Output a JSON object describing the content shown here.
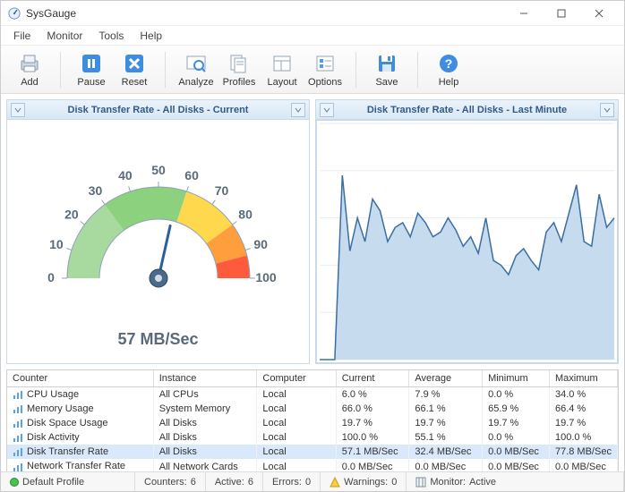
{
  "window": {
    "title": "SysGauge"
  },
  "menu": {
    "file": "File",
    "monitor": "Monitor",
    "tools": "Tools",
    "help": "Help"
  },
  "toolbar": {
    "add": "Add",
    "pause": "Pause",
    "reset": "Reset",
    "analyze": "Analyze",
    "profiles": "Profiles",
    "layout": "Layout",
    "options": "Options",
    "save": "Save",
    "help": "Help"
  },
  "panels": {
    "gauge": {
      "title": "Disk Transfer Rate - All Disks - Current",
      "value_label": "57 MB/Sec",
      "value": 57,
      "max": 100,
      "ticks": [
        "0",
        "10",
        "20",
        "30",
        "40",
        "50",
        "60",
        "70",
        "80",
        "90",
        "100"
      ]
    },
    "chart": {
      "title": "Disk Transfer Rate - All Disks - Last Minute"
    }
  },
  "chart_data": {
    "type": "line",
    "title": "Disk Transfer Rate - All Disks - Last Minute",
    "xlabel": "",
    "ylabel": "",
    "ylim": [
      0,
      100
    ],
    "x": [
      0,
      1,
      2,
      3,
      4,
      5,
      6,
      7,
      8,
      9,
      10,
      11,
      12,
      13,
      14,
      15,
      16,
      17,
      18,
      19,
      20,
      21,
      22,
      23,
      24,
      25,
      26,
      27,
      28,
      29,
      30,
      31,
      32,
      33,
      34,
      35,
      36,
      37,
      38,
      39
    ],
    "values": [
      0,
      0,
      0,
      78,
      46,
      60,
      50,
      68,
      63,
      50,
      56,
      58,
      52,
      62,
      58,
      52,
      54,
      60,
      55,
      48,
      52,
      45,
      60,
      42,
      40,
      36,
      44,
      47,
      42,
      38,
      54,
      58,
      50,
      62,
      74,
      50,
      48,
      70,
      56,
      60
    ]
  },
  "counters": {
    "headers": {
      "counter": "Counter",
      "instance": "Instance",
      "computer": "Computer",
      "current": "Current",
      "average": "Average",
      "minimum": "Minimum",
      "maximum": "Maximum"
    },
    "rows": [
      {
        "counter": "CPU Usage",
        "instance": "All CPUs",
        "computer": "Local",
        "current": "6.0 %",
        "average": "7.9 %",
        "minimum": "0.0 %",
        "maximum": "34.0 %"
      },
      {
        "counter": "Memory Usage",
        "instance": "System Memory",
        "computer": "Local",
        "current": "66.0 %",
        "average": "66.1 %",
        "minimum": "65.9 %",
        "maximum": "66.4 %"
      },
      {
        "counter": "Disk Space Usage",
        "instance": "All Disks",
        "computer": "Local",
        "current": "19.7 %",
        "average": "19.7 %",
        "minimum": "19.7 %",
        "maximum": "19.7 %"
      },
      {
        "counter": "Disk Activity",
        "instance": "All Disks",
        "computer": "Local",
        "current": "100.0 %",
        "average": "55.1 %",
        "minimum": "0.0 %",
        "maximum": "100.0 %"
      },
      {
        "counter": "Disk Transfer Rate",
        "instance": "All Disks",
        "computer": "Local",
        "current": "57.1 MB/Sec",
        "average": "32.4 MB/Sec",
        "minimum": "0.0 MB/Sec",
        "maximum": "77.8 MB/Sec"
      },
      {
        "counter": "Network Transfer Rate",
        "instance": "All Network Cards",
        "computer": "Local",
        "current": "0.0 MB/Sec",
        "average": "0.0 MB/Sec",
        "minimum": "0.0 MB/Sec",
        "maximum": "0.0 MB/Sec"
      }
    ],
    "selected_index": 4
  },
  "status": {
    "profile": "Default Profile",
    "counters_label": "Counters:",
    "counters_value": "6",
    "active_label": "Active:",
    "active_value": "6",
    "errors_label": "Errors:",
    "errors_value": "0",
    "warnings_label": "Warnings:",
    "warnings_value": "0",
    "monitor_label": "Monitor:",
    "monitor_value": "Active"
  }
}
